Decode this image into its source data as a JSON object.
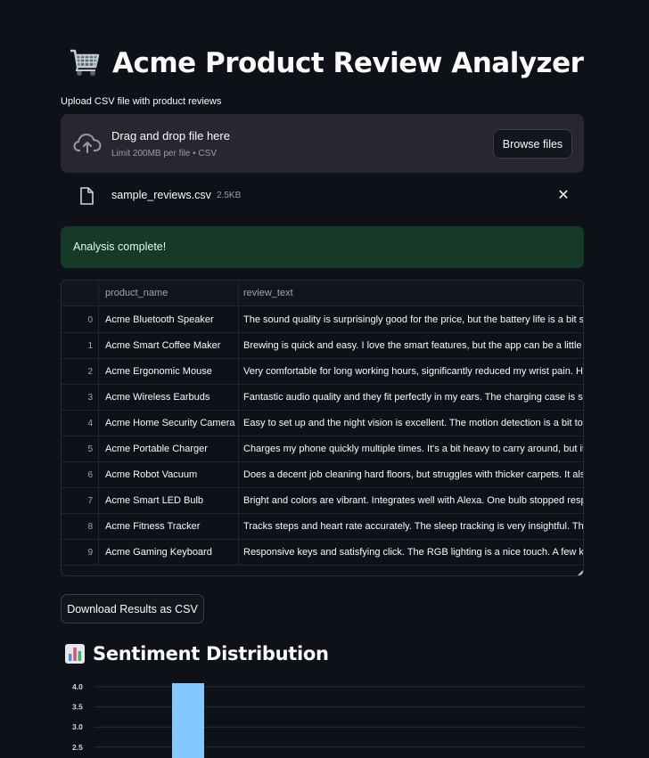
{
  "app": {
    "title": "Acme Product Review Analyzer",
    "title_icon": "shopping-cart-icon"
  },
  "uploader": {
    "label": "Upload CSV file with product reviews",
    "drop_text": "Drag and drop file here",
    "limit_text": "Limit 200MB per file • CSV",
    "browse_label": "Browse files",
    "file": {
      "name": "sample_reviews.csv",
      "size": "2.5KB"
    }
  },
  "status": {
    "message": "Analysis complete!",
    "color": "#173928"
  },
  "table": {
    "columns": [
      "",
      "product_name",
      "review_text"
    ],
    "rows": [
      {
        "idx": "0",
        "product_name": "Acme Bluetooth Speaker",
        "review_text": "The sound quality is surprisingly good for the price, but the battery life is a bit s"
      },
      {
        "idx": "1",
        "product_name": "Acme Smart Coffee Maker",
        "review_text": "Brewing is quick and easy. I love the smart features, but the app can be a little b"
      },
      {
        "idx": "2",
        "product_name": "Acme Ergonomic Mouse",
        "review_text": "Very comfortable for long working hours, significantly reduced my wrist pain. H"
      },
      {
        "idx": "3",
        "product_name": "Acme Wireless Earbuds",
        "review_text": "Fantastic audio quality and they fit perfectly in my ears. The charging case is sle"
      },
      {
        "idx": "4",
        "product_name": "Acme Home Security Camera",
        "review_text": "Easy to set up and the night vision is excellent. The motion detection is a bit too"
      },
      {
        "idx": "5",
        "product_name": "Acme Portable Charger",
        "review_text": "Charges my phone quickly multiple times. It's a bit heavy to carry around, but it"
      },
      {
        "idx": "6",
        "product_name": "Acme Robot Vacuum",
        "review_text": "Does a decent job cleaning hard floors, but struggles with thicker carpets. It also"
      },
      {
        "idx": "7",
        "product_name": "Acme Smart LED Bulb",
        "review_text": "Bright and colors are vibrant. Integrates well with Alexa. One bulb stopped resp"
      },
      {
        "idx": "8",
        "product_name": "Acme Fitness Tracker",
        "review_text": "Tracks steps and heart rate accurately. The sleep tracking is very insightful. The"
      },
      {
        "idx": "9",
        "product_name": "Acme Gaming Keyboard",
        "review_text": "Responsive keys and satisfying click. The RGB lighting is a nice touch. A few key"
      }
    ]
  },
  "download": {
    "label": "Download Results as CSV"
  },
  "section": {
    "title": "Sentiment Distribution",
    "icon": "bar-chart-icon"
  },
  "chart_data": {
    "type": "bar",
    "yticks": [
      "4.0",
      "3.5",
      "3.0",
      "2.5"
    ],
    "ylim_visible": [
      2.3,
      4.0
    ],
    "series": [
      {
        "values": [
          4
        ]
      }
    ],
    "bar_color": "#83c9ff",
    "grid": true
  }
}
